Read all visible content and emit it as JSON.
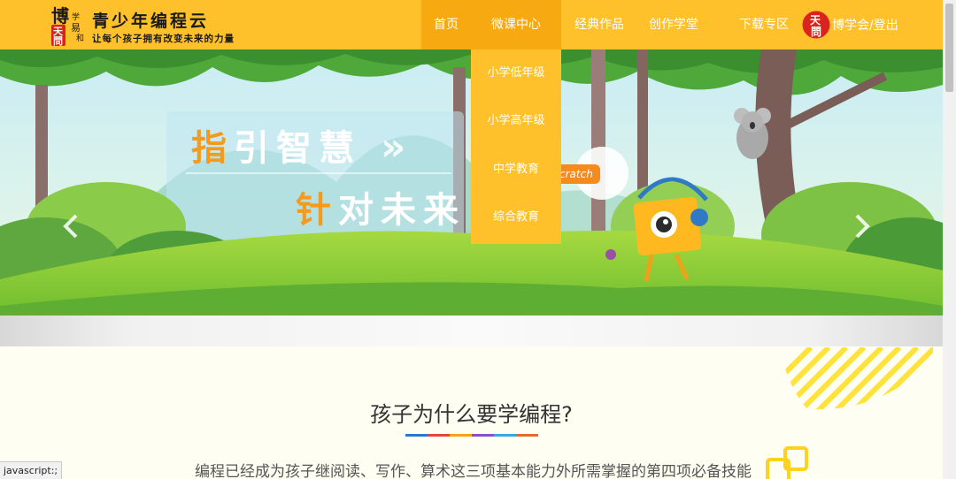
{
  "header": {
    "logo_seal_chars": [
      "博",
      "学",
      "易",
      "和",
      "天",
      "問"
    ],
    "logo_title": "青少年编程云",
    "logo_slogan": "让每个孩子拥有改变未来的力量",
    "nav": [
      {
        "label": "首页",
        "active": true
      },
      {
        "label": "微课中心",
        "open": true
      },
      {
        "label": "经典作品"
      },
      {
        "label": "创作学堂"
      },
      {
        "label": "下载专区"
      }
    ],
    "user_badge_text": "天問",
    "user_link_brand": "博学会",
    "user_link_sep": "/",
    "user_link_logout": "登出"
  },
  "dropdown": {
    "items": [
      "小学低年级",
      "小学高年级",
      "中学教育",
      "综合教育"
    ]
  },
  "banner": {
    "line1_highlight": "指",
    "line1_rest": "引智慧",
    "line1_arrows": "»",
    "line2_highlight": "针",
    "line2_rest": "对未来",
    "scratch_tag": "cratch",
    "prev_icon": "chevron-left-icon",
    "next_icon": "chevron-right-icon"
  },
  "section": {
    "title": "孩子为什么要学编程?",
    "description": "编程已经成为孩子继阅读、写作、算术这三项基本能力外所需掌握的第四项必备技能",
    "underline_colors": [
      "#2b78c5",
      "#e6443a",
      "#f2a517",
      "#8b4fc3",
      "#3aa7d8",
      "#e66a2c"
    ]
  },
  "status_bar": {
    "text": "javascript:;"
  },
  "colors": {
    "header_bg": "#ffc12b",
    "nav_active_bg": "#f7a912",
    "accent_orange": "#f49a1c",
    "page_bg": "#fffef2"
  }
}
